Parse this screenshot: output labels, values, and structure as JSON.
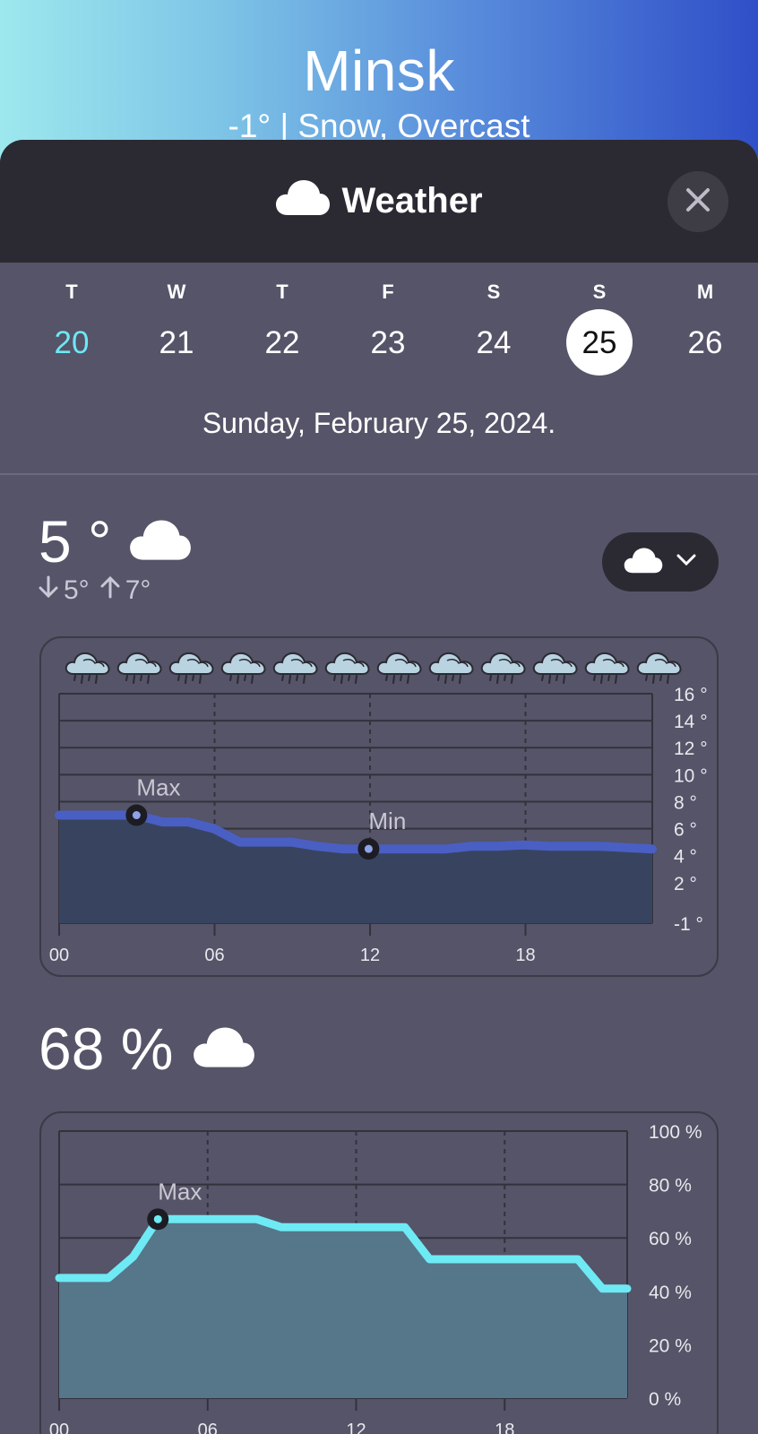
{
  "header": {
    "city": "Minsk",
    "condition": "-1° | Snow, Overcast"
  },
  "sheet": {
    "title": "Weather",
    "title_icon": "cloud-icon",
    "close_icon": "close-icon"
  },
  "calendar": {
    "days": [
      {
        "dow": "T",
        "num": "20",
        "state": "today"
      },
      {
        "dow": "W",
        "num": "21",
        "state": ""
      },
      {
        "dow": "T",
        "num": "22",
        "state": ""
      },
      {
        "dow": "F",
        "num": "23",
        "state": ""
      },
      {
        "dow": "S",
        "num": "24",
        "state": ""
      },
      {
        "dow": "S",
        "num": "25",
        "state": "selected"
      },
      {
        "dow": "M",
        "num": "26",
        "state": ""
      }
    ],
    "selected_date": "Sunday, February 25, 2024."
  },
  "current": {
    "temp": "5 °",
    "low": "5°",
    "high": "7°",
    "icon": "cloud-icon",
    "selector_icon": "cloud-icon",
    "selector_chevron": "chevron-down-icon"
  },
  "humidity": {
    "value": "68 %",
    "icon": "cloud-icon"
  },
  "colors": {
    "today": "#6ee8f5",
    "temp_line": "#4a5fc4",
    "humidity_line": "#6eeaf4",
    "sheet_bg": "#555468",
    "header_bg": "#2b2a33"
  },
  "chart_data": [
    {
      "type": "area",
      "x": [
        "00",
        "01",
        "02",
        "03",
        "04",
        "05",
        "06",
        "07",
        "08",
        "09",
        "10",
        "11",
        "12",
        "13",
        "14",
        "15",
        "16",
        "17",
        "18",
        "19",
        "20",
        "21",
        "22",
        "23"
      ],
      "series": [
        {
          "values": [
            7,
            7,
            7,
            7,
            6.5,
            6.5,
            6,
            5,
            5,
            5,
            4.7,
            4.5,
            4.5,
            4.5,
            4.5,
            4.5,
            4.7,
            4.7,
            4.8,
            4.7,
            4.7,
            4.7,
            4.6,
            4.5
          ]
        }
      ],
      "xlabel": "",
      "ylabel": "",
      "x_ticks": [
        "00",
        "06",
        "12",
        "18"
      ],
      "y_ticks": [
        "16 °",
        "14 °",
        "12 °",
        "10 °",
        "8 °",
        "6 °",
        "4 °",
        "2 °",
        "-1 °"
      ],
      "ylim": [
        -1,
        16
      ],
      "annotations": [
        {
          "label": "Max",
          "x": "03",
          "y": 7
        },
        {
          "label": "Min",
          "x": "12",
          "y": 4.5
        }
      ],
      "hourly_icons": "snow-cloud-icon",
      "hourly_icon_count": 12
    },
    {
      "type": "area",
      "x": [
        "00",
        "01",
        "02",
        "03",
        "04",
        "05",
        "06",
        "07",
        "08",
        "09",
        "10",
        "11",
        "12",
        "13",
        "14",
        "15",
        "16",
        "17",
        "18",
        "19",
        "20",
        "21",
        "22",
        "23"
      ],
      "series": [
        {
          "values": [
            45,
            45,
            45,
            53,
            67,
            67,
            67,
            67,
            67,
            64,
            64,
            64,
            64,
            64,
            64,
            52,
            52,
            52,
            52,
            52,
            52,
            52,
            41,
            41
          ]
        }
      ],
      "xlabel": "",
      "ylabel": "",
      "x_ticks": [
        "00",
        "06",
        "12",
        "18"
      ],
      "y_ticks": [
        "100 %",
        "80 %",
        "60 %",
        "40 %",
        "20 %",
        "0 %"
      ],
      "ylim": [
        0,
        100
      ],
      "annotations": [
        {
          "label": "Max",
          "x": "04",
          "y": 67
        }
      ]
    }
  ]
}
